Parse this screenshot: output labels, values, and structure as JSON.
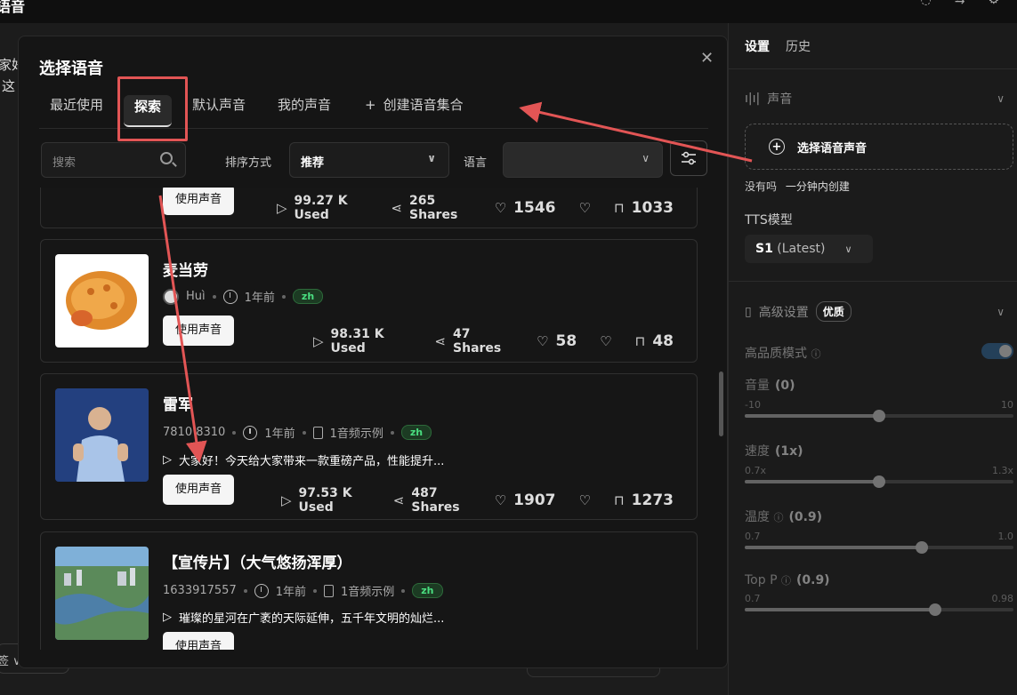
{
  "app": {
    "title": "语音",
    "bg_text_1": "家好",
    "bg_text_2": "这",
    "bottom_left_text": "签 ∨"
  },
  "right_panel": {
    "tabs": [
      "设置",
      "历史"
    ],
    "voice_section": "声音",
    "select_voice": "选择语音声音",
    "no_voice_text": "没有吗",
    "create_link": "一分钟内创建",
    "tts_label": "TTS模型",
    "model_value": "S1",
    "model_suffix": "(Latest)",
    "advanced_label": "高级设置",
    "advanced_badge": "优质",
    "hq_mode": "高品质模式",
    "sliders": [
      {
        "label": "音量",
        "value": "(0)",
        "min": "-10",
        "max": "10",
        "fraction": 0.5
      },
      {
        "label": "速度",
        "value": "(1x)",
        "min": "0.7x",
        "max": "1.3x",
        "fraction": 0.5
      },
      {
        "label": "温度",
        "value": "(0.9)",
        "min": "0.7",
        "max": "1.0",
        "fraction": 0.66
      },
      {
        "label": "Top P",
        "value": "(0.9)",
        "min": "0.7",
        "max": "0.98",
        "fraction": 0.71
      }
    ]
  },
  "modal": {
    "title": "选择语音",
    "tabs": [
      "最近使用",
      "探索",
      "默认声音",
      "我的声音",
      "创建语音集合"
    ],
    "search_placeholder": "搜索",
    "sort_label": "排序方式",
    "sort_value": "推荐",
    "language_label": "语言",
    "use_button": "使用声音",
    "cards": [
      {
        "title": "",
        "used": "99.27 K Used",
        "shares": "265 Shares",
        "likes": "1546",
        "saves": "1033"
      },
      {
        "title": "麦当劳",
        "author": "Huì",
        "time": "1年前",
        "lang": "zh",
        "used": "98.31 K Used",
        "shares": "47 Shares",
        "likes": "58",
        "saves": "48"
      },
      {
        "title": "雷军",
        "author": "7810 8310",
        "time": "1年前",
        "samples": "1音频示例",
        "lang": "zh",
        "desc": "大家好！今天给大家带来一款重磅产品，性能提升...",
        "used": "97.53 K Used",
        "shares": "487 Shares",
        "likes": "1907",
        "saves": "1273"
      },
      {
        "title": "【宣传片】（大气悠扬浑厚）",
        "author": "1633917557",
        "time": "1年前",
        "samples": "1音频示例",
        "lang": "zh",
        "desc": "璀璨的星河在广袤的天际延伸，五千年文明的灿烂..."
      }
    ]
  }
}
